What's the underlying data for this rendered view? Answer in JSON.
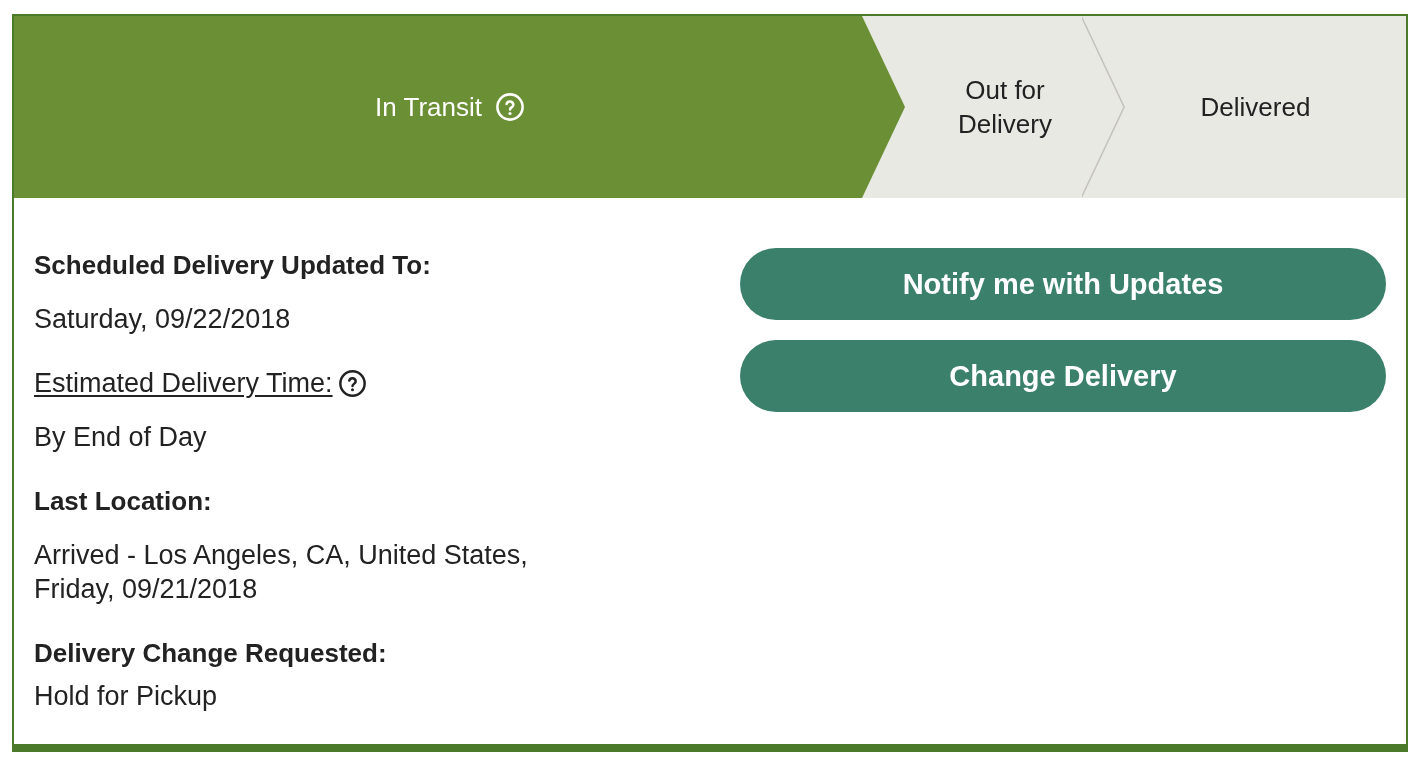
{
  "progress": {
    "steps": [
      {
        "label": "In Transit",
        "current": true,
        "has_help": true
      },
      {
        "label": "Out for Delivery",
        "current": false,
        "has_help": false
      },
      {
        "label": "Delivered",
        "current": false,
        "has_help": false
      }
    ]
  },
  "details": {
    "fields": [
      {
        "kind": "heading",
        "label": "Scheduled Delivery Updated To:",
        "value": "Saturday, 09/22/2018",
        "has_help": false
      },
      {
        "kind": "link",
        "label": "Estimated Delivery Time:",
        "value": "By End of Day",
        "has_help": true
      },
      {
        "kind": "heading",
        "label": "Last Location:",
        "value": "Arrived - Los Angeles, CA, United States, Friday, 09/21/2018",
        "has_help": false
      },
      {
        "kind": "heading",
        "label": "Delivery Change Requested:",
        "value": "Hold for Pickup",
        "has_help": false
      }
    ]
  },
  "actions": {
    "buttons": [
      "Notify me with Updates",
      "Change Delivery"
    ]
  }
}
